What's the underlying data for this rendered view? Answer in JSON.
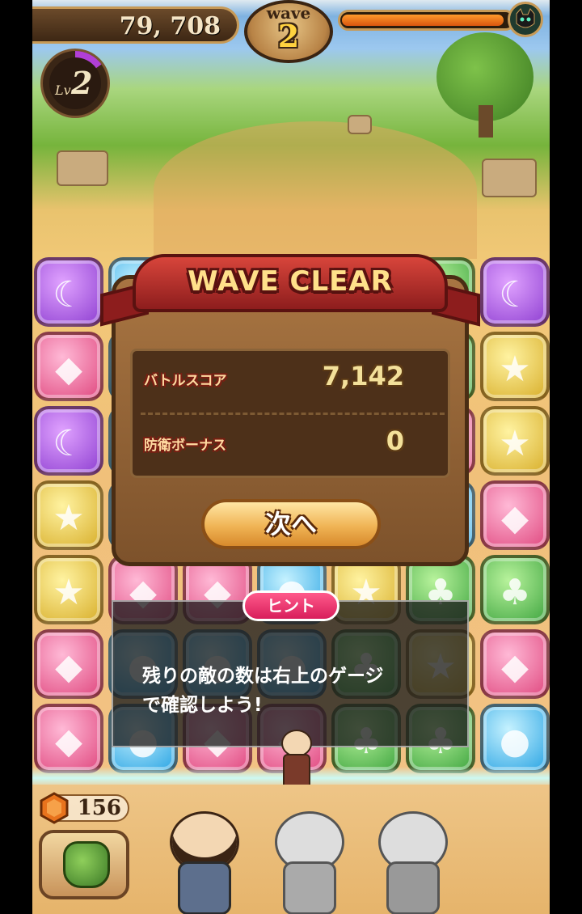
{
  "hud": {
    "score": "79, 708",
    "wave_label": "wave",
    "wave_number": "2",
    "level_prefix": "Lv",
    "level_number": "2",
    "enemy_gauge_fraction": 0.95,
    "level_progress_fraction": 0.15
  },
  "wave_clear_dialog": {
    "title": "WAVE CLEAR",
    "battle_score_label": "バトルスコア",
    "battle_score_value": "7,142",
    "defense_bonus_label": "防衛ボーナス",
    "defense_bonus_value": "0",
    "next_button": "次へ"
  },
  "hint": {
    "badge": "ヒント",
    "line1": "残りの敵の数は右上のゲージ",
    "line2": "で確認しよう!"
  },
  "footer": {
    "gem_count": "156"
  },
  "grid": {
    "columns": 7,
    "rows": 7,
    "tiles": [
      [
        "purple",
        "blue",
        "purple",
        "green",
        "blue",
        "green",
        "purple"
      ],
      [
        "pink",
        "blue",
        "purple",
        "green",
        "blue",
        "green",
        "yellow"
      ],
      [
        "purple",
        "blue",
        "purple",
        "green",
        "blue",
        "pink",
        "yellow"
      ],
      [
        "yellow",
        "blue",
        "purple",
        "green",
        "blue",
        "blue",
        "pink"
      ],
      [
        "yellow",
        "pink",
        "pink",
        "blue",
        "yellow",
        "green",
        "green"
      ],
      [
        "pink",
        "blue",
        "blue",
        "blue",
        "green",
        "yellow",
        "pink"
      ],
      [
        "pink",
        "blue",
        "pink",
        "pink",
        "green",
        "green",
        "blue"
      ]
    ]
  },
  "tile_icons": {
    "purple": "moon-icon",
    "pink": "diamond-icon",
    "yellow": "star-icon",
    "green": "clover-icon",
    "blue": "droplet-icon"
  },
  "colors": {
    "ribbon": "#c0302b",
    "dialog": "#8b5e34",
    "next_button": "#f0b455",
    "hint_badge": "#e6306b"
  }
}
